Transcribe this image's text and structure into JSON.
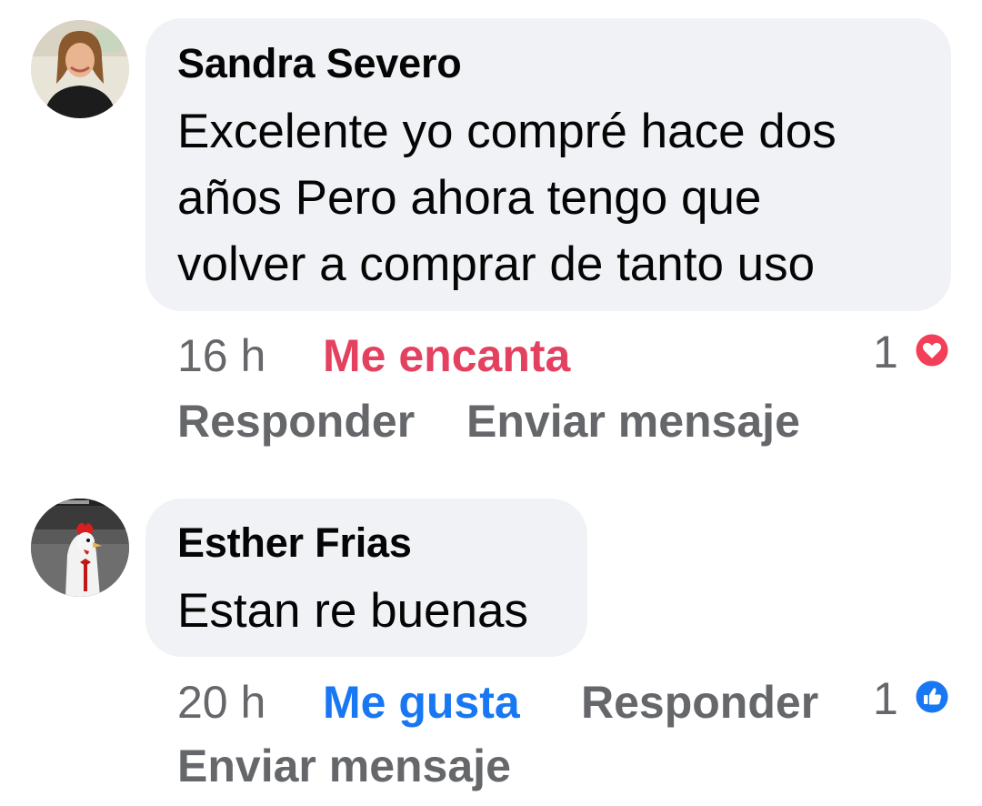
{
  "comments": [
    {
      "author": "Sandra Severo",
      "text_lines": [
        "Excelente yo compré hace dos",
        "años Pero ahora tengo que",
        "volver a comprar de tanto uso"
      ],
      "time": "16 h",
      "reaction_label": "Me encanta",
      "reaction_color": "#e4405f",
      "reply_label": "Responder",
      "message_label": "Enviar mensaje",
      "reaction_count": "1",
      "reaction_icon": "love-heart-icon",
      "avatar_icon": "user-avatar-photo"
    },
    {
      "author": "Esther Frias",
      "text_lines": [
        "Estan re buenas"
      ],
      "time": "20 h",
      "reaction_label": "Me gusta",
      "reaction_color": "#1877f2",
      "reply_label": "Responder",
      "message_label": "Enviar mensaje",
      "reaction_count": "1",
      "reaction_icon": "like-thumb-icon",
      "avatar_icon": "rooster-avatar-photo"
    }
  ]
}
